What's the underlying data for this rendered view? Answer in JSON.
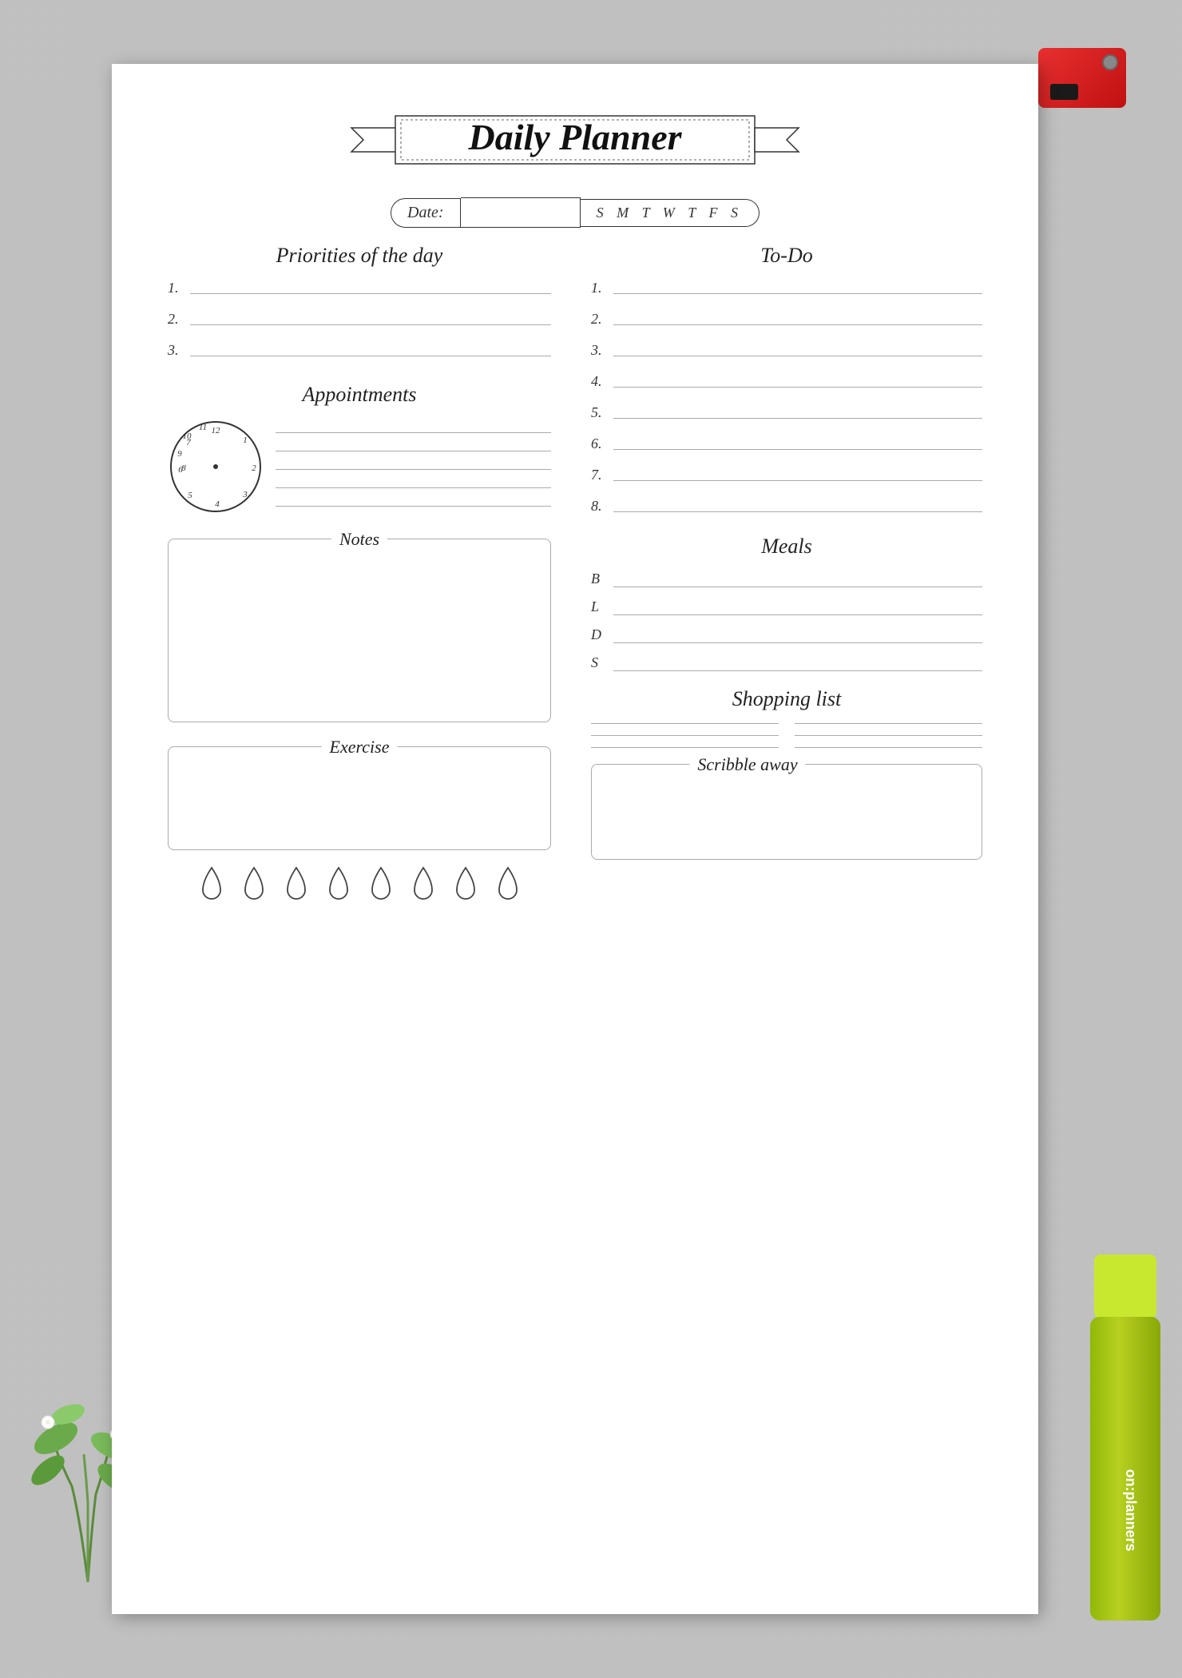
{
  "page": {
    "background_color": "#c5c5c5",
    "paper_color": "#ffffff"
  },
  "header": {
    "title": "Daily Planner",
    "date_label": "Date:",
    "days": "S  M  T  W  T  F  S"
  },
  "priorities": {
    "section_title": "Priorities of the day",
    "items": [
      "1.",
      "2.",
      "3."
    ]
  },
  "appointments": {
    "section_title": "Appointments",
    "clock_numbers": [
      "12",
      "1",
      "2",
      "3",
      "4",
      "5",
      "6",
      "7",
      "8",
      "9",
      "10",
      "11"
    ],
    "lines_count": 5
  },
  "notes": {
    "section_title": "Notes"
  },
  "exercise": {
    "section_title": "Exercise"
  },
  "water": {
    "drops_count": 8
  },
  "todo": {
    "section_title": "To-Do",
    "items": [
      "1.",
      "2.",
      "3.",
      "4.",
      "5.",
      "6.",
      "7.",
      "8."
    ]
  },
  "meals": {
    "section_title": "Meals",
    "items": [
      {
        "label": "B"
      },
      {
        "label": "L"
      },
      {
        "label": "D"
      },
      {
        "label": "S"
      }
    ]
  },
  "shopping": {
    "section_title": "Shopping list",
    "lines_count": 6
  },
  "scribble": {
    "section_title": "Scribble away"
  },
  "branding": {
    "text": "on:planners"
  }
}
